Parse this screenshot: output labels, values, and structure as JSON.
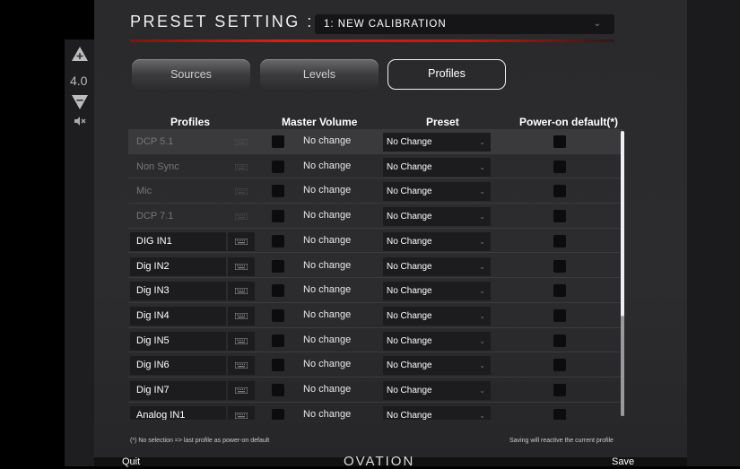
{
  "header": {
    "title": "PRESET SETTING :",
    "preset_value": "1: NEW CALIBRATION"
  },
  "volume": {
    "value": "4.0"
  },
  "tabs": [
    {
      "label": "Sources",
      "active": false
    },
    {
      "label": "Levels",
      "active": false
    },
    {
      "label": "Profiles",
      "active": true
    }
  ],
  "columns": {
    "profiles": "Profiles",
    "master_volume": "Master Volume",
    "preset": "Preset",
    "power_on": "Power-on default(*)"
  },
  "rows": [
    {
      "name": "DCP 5.1",
      "master_volume": "No change",
      "preset": "No Change",
      "dim": true
    },
    {
      "name": "Non Sync",
      "master_volume": "No change",
      "preset": "No Change",
      "dim": true
    },
    {
      "name": "Mic",
      "master_volume": "No change",
      "preset": "No Change",
      "dim": true
    },
    {
      "name": "DCP 7.1",
      "master_volume": "No change",
      "preset": "No Change",
      "dim": true
    },
    {
      "name": "DIG IN1",
      "master_volume": "No change",
      "preset": "No Change",
      "dim": false
    },
    {
      "name": "Dig IN2",
      "master_volume": "No change",
      "preset": "No Change",
      "dim": false
    },
    {
      "name": "Dig IN3",
      "master_volume": "No change",
      "preset": "No Change",
      "dim": false
    },
    {
      "name": "Dig IN4",
      "master_volume": "No change",
      "preset": "No Change",
      "dim": false
    },
    {
      "name": "Dig IN5",
      "master_volume": "No change",
      "preset": "No Change",
      "dim": false
    },
    {
      "name": "Dig IN6",
      "master_volume": "No change",
      "preset": "No Change",
      "dim": false
    },
    {
      "name": "Dig IN7",
      "master_volume": "No change",
      "preset": "No Change",
      "dim": false
    },
    {
      "name": "Analog IN1",
      "master_volume": "No change",
      "preset": "No Change",
      "dim": false
    }
  ],
  "notes": {
    "left": "(*) No selection => last profile as power-on default",
    "right": "Saving will reactive the current profile"
  },
  "footer": {
    "quit": "Quit",
    "logo": "OVATION",
    "save": "Save"
  },
  "icons": {
    "volume_up": "plus-triangle-up-icon",
    "volume_down": "triangle-down-icon",
    "mute": "speaker-mute-icon",
    "keyboard": "keyboard-icon",
    "dropdown": "chevron-down-icon"
  },
  "colors": {
    "accent_red": "#d02020",
    "background": "#2a2a2c",
    "field": "#1c1c1e"
  }
}
